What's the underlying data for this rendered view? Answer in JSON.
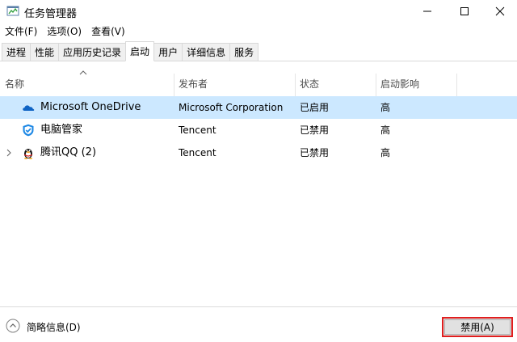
{
  "window": {
    "title": "任务管理器"
  },
  "menu": [
    {
      "label": "文件(F)"
    },
    {
      "label": "选项(O)"
    },
    {
      "label": "查看(V)"
    }
  ],
  "tabs": [
    {
      "label": "进程"
    },
    {
      "label": "性能"
    },
    {
      "label": "应用历史记录"
    },
    {
      "label": "启动",
      "active": true
    },
    {
      "label": "用户"
    },
    {
      "label": "详细信息"
    },
    {
      "label": "服务"
    }
  ],
  "columns": {
    "name": "名称",
    "publisher": "发布者",
    "status": "状态",
    "impact": "启动影响",
    "sorted_by": "name",
    "sort_direction": "ascending"
  },
  "rows": [
    {
      "name": "Microsoft OneDrive",
      "publisher": "Microsoft Corporation",
      "status": "已启用",
      "impact": "高",
      "icon": "onedrive-icon",
      "selected": true
    },
    {
      "name": "电脑管家",
      "publisher": "Tencent",
      "status": "已禁用",
      "impact": "高",
      "icon": "pc-manager-icon"
    },
    {
      "name": "腾讯QQ (2)",
      "publisher": "Tencent",
      "status": "已禁用",
      "impact": "高",
      "icon": "qq-penguin-icon",
      "expandable": true
    }
  ],
  "footer": {
    "fewer_details": "简略信息(D)",
    "disable_button": "禁用(A)"
  },
  "colors": {
    "selection": "#cce8ff",
    "highlight_border": "#e01f1f",
    "onedrive": "#0f63c4",
    "pc_manager": "#1e88e5"
  }
}
